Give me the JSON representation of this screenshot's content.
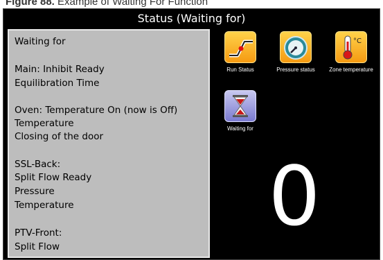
{
  "caption": {
    "bold": "Figure 88.",
    "text": " Example of Waiting For Function"
  },
  "window": {
    "title": "Status (Waiting for)"
  },
  "status_panel": {
    "lines": [
      "Waiting for",
      "Main: Inhibit Ready",
      "Equilibration Time",
      "Oven:  Temperature On (now is Off)",
      "Temperature",
      " Closing of the door",
      "SSL-Back:",
      " Split Flow Ready",
      " Pressure",
      " Temperature",
      "PTV-Front:",
      " Split Flow"
    ]
  },
  "tiles": [
    {
      "label": "Run Status",
      "icon": "run-status-icon"
    },
    {
      "label": "Pressure status",
      "icon": "pressure-gauge-icon"
    },
    {
      "label": "Zone temperature",
      "icon": "thermometer-icon"
    },
    {
      "label": "Waiting for",
      "icon": "hourglass-icon"
    }
  ],
  "counter": {
    "value": "0"
  },
  "colors": {
    "screen_bg": "#000000",
    "panel_bg": "#bdbdbd",
    "tile_orange": "#f59a12",
    "tile_blue": "#7a7ad0"
  }
}
